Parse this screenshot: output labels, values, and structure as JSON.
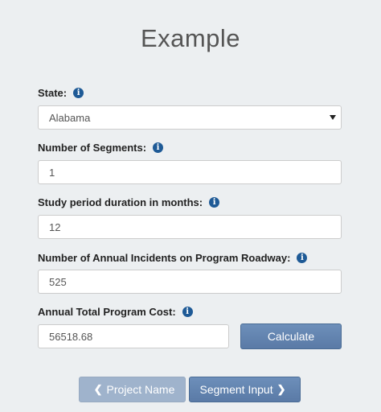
{
  "page": {
    "title": "Example"
  },
  "form": {
    "state": {
      "label": "State:",
      "value": "Alabama",
      "info_icon": "info-icon"
    },
    "segments": {
      "label": "Number of Segments:",
      "value": "1",
      "info_icon": "info-icon"
    },
    "study_period": {
      "label": "Study period duration in months:",
      "value": "12",
      "info_icon": "info-icon"
    },
    "incidents": {
      "label": "Number of Annual Incidents on Program Roadway:",
      "value": "525",
      "info_icon": "info-icon"
    },
    "cost": {
      "label": "Annual Total Program Cost:",
      "value": "56518.68",
      "info_icon": "info-icon"
    },
    "calculate_label": "Calculate"
  },
  "nav": {
    "back_label": "Project Name",
    "back_icon": "chevron-left-icon",
    "next_label": "Segment Input",
    "next_icon": "chevron-right-icon"
  },
  "colors": {
    "background": "#eceff1",
    "info_icon": "#1e5a96",
    "primary_button": "#5d7ea9",
    "muted_button": "#9fb3cc"
  }
}
